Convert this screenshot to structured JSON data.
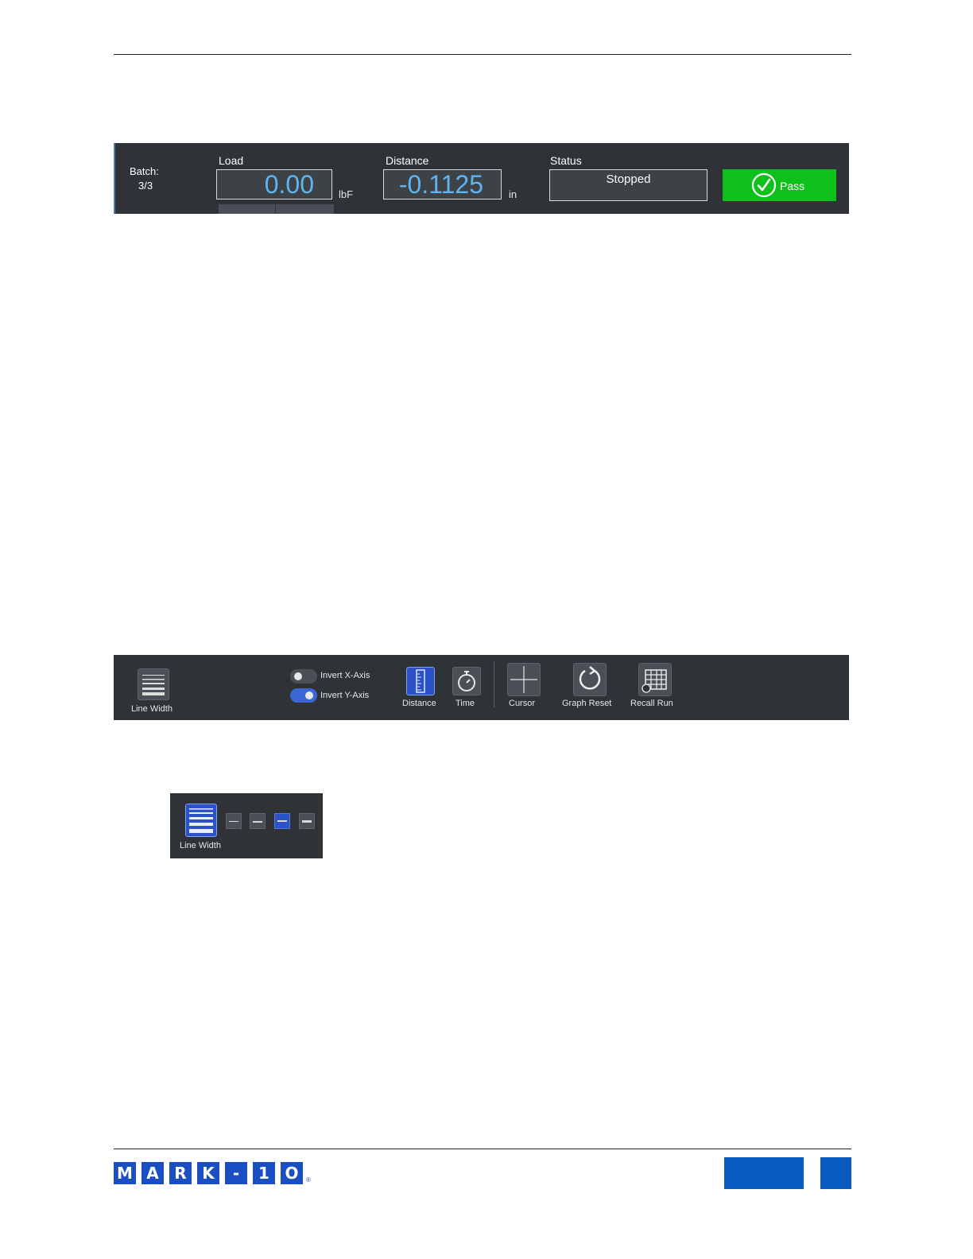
{
  "status_panel": {
    "batch_label": "Batch:",
    "batch_value": "3/3",
    "load": {
      "title": "Load",
      "value": "0.00",
      "unit": "lbF"
    },
    "distance": {
      "title": "Distance",
      "value": "-0.1125",
      "unit": "in"
    },
    "status": {
      "title": "Status",
      "value": "Stopped"
    },
    "pass": {
      "label": "Pass",
      "color": "#0ec11a"
    }
  },
  "toolbar": {
    "line_width_label": "Line Width",
    "invert_x_label": "Invert X-Axis",
    "invert_x_on": false,
    "invert_y_label": "Invert Y-Axis",
    "invert_y_on": true,
    "distance_label": "Distance",
    "time_label": "Time",
    "cursor_label": "Cursor",
    "graph_reset_label": "Graph Reset",
    "recall_run_label": "Recall Run",
    "accent_color": "#2b52c8"
  },
  "line_width_popup": {
    "label": "Line Width",
    "options": [
      "thinnest",
      "thin",
      "thick",
      "thickest"
    ],
    "selected_index": 2
  },
  "footer": {
    "logo_letters": [
      "M",
      "A",
      "R",
      "K",
      "-",
      "1",
      "O"
    ],
    "logo_reg": "®",
    "brand_color": "#1a4fc4"
  }
}
